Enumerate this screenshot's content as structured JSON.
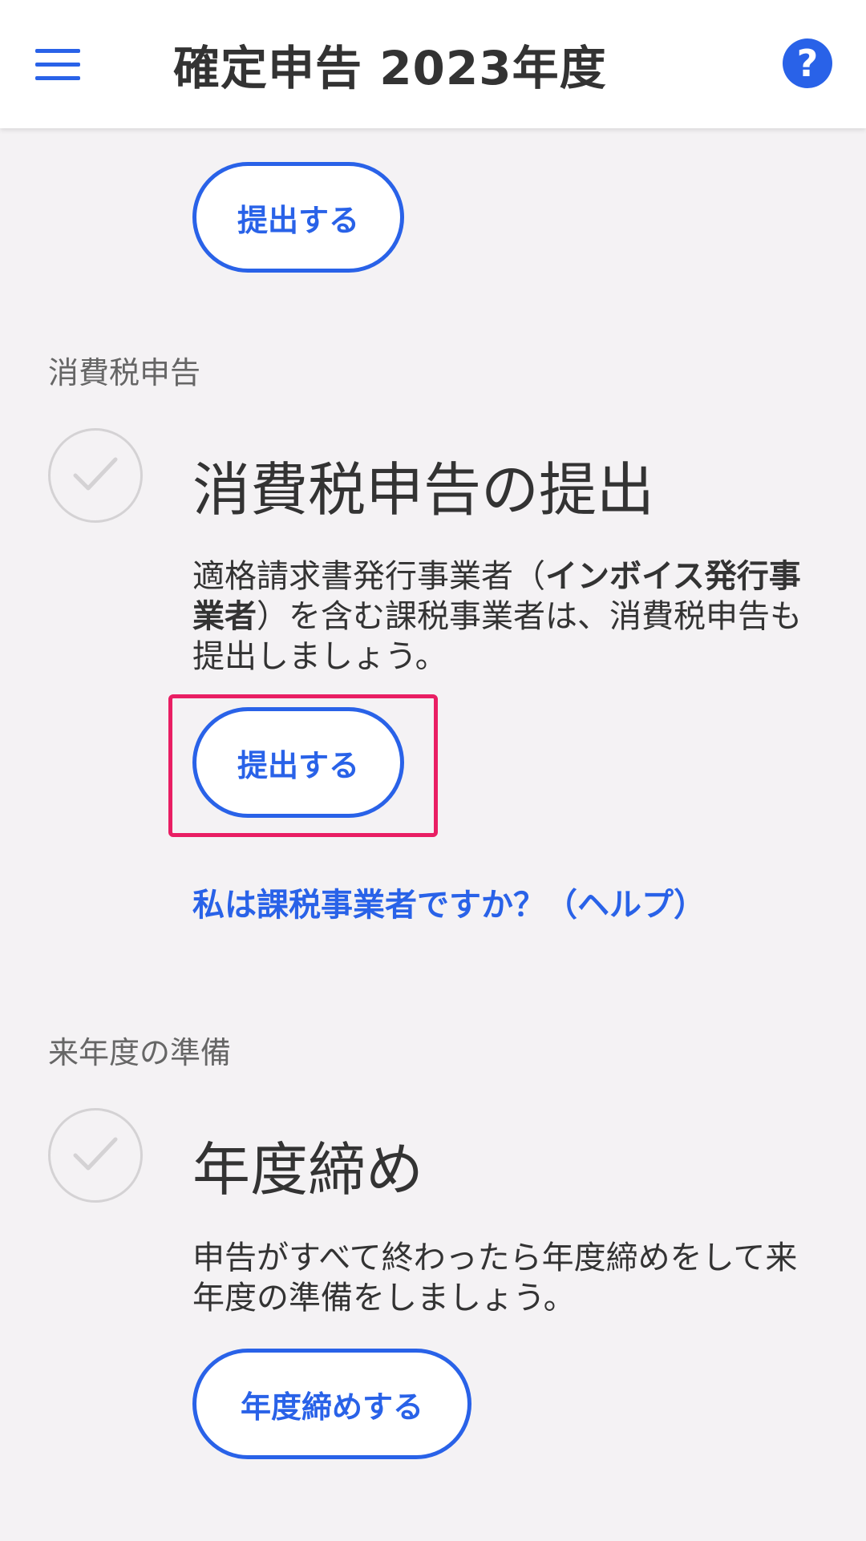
{
  "header": {
    "title": "確定申告 2023年度",
    "menu_icon": "hamburger-menu-icon",
    "help_icon": "question-mark",
    "help_glyph": "?"
  },
  "top_section": {
    "submit_label": "提出する"
  },
  "consumption_tax": {
    "section_label": "消費税申告",
    "task_title": "消費税申告の提出",
    "description_part1": "適格請求書発行事業者（",
    "description_bold1": "インボイス発行事業者",
    "description_part2": "）を含む課税事業者は、消費税申告も提出しましょう。",
    "submit_label": "提出する",
    "help_link": "私は課税事業者ですか？（ヘルプ）"
  },
  "next_year": {
    "section_label": "来年度の準備",
    "task_title": "年度締め",
    "description": "申告がすべて終わったら年度締めをして来年度の準備をしましょう。",
    "close_label": "年度締めする"
  },
  "colors": {
    "accent": "#2962e8",
    "highlight": "#e91e63",
    "background": "#f4f2f4"
  }
}
